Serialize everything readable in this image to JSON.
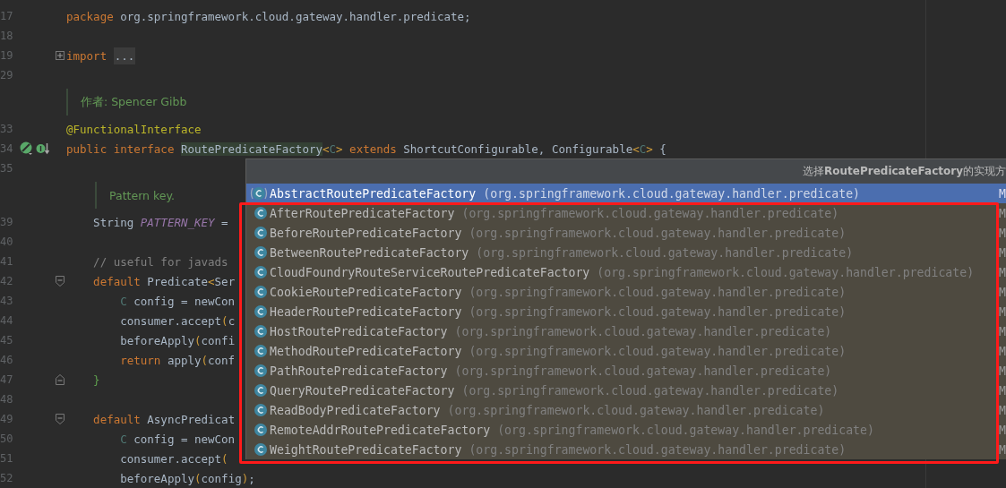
{
  "editor": {
    "lines": [
      {
        "kind": "code",
        "number": "17",
        "tokens": [
          {
            "kind": "keyword",
            "text": "package"
          },
          {
            "kind": "plain",
            "text": " org.springframework.cloud.gateway.handler.predicate;"
          }
        ]
      },
      {
        "kind": "code",
        "number": "18"
      },
      {
        "kind": "code",
        "number": "19",
        "fold": {
          "kind": "collapsed"
        },
        "tokens": [
          {
            "kind": "keyword",
            "text": "import "
          },
          {
            "kind": "folded",
            "text": "..."
          }
        ]
      },
      {
        "kind": "code",
        "number": "29"
      },
      {
        "kind": "doc",
        "text": "作者: Spencer Gibb"
      },
      {
        "kind": "code",
        "number": "33",
        "tokens": [
          {
            "kind": "annotation",
            "text": "@FunctionalInterface"
          }
        ]
      },
      {
        "kind": "code",
        "number": "34",
        "markers": true,
        "tokens": [
          {
            "kind": "keyword",
            "text": "public interface "
          },
          {
            "kind": "highlight",
            "text": "RoutePredicateFactory"
          },
          {
            "kind": "bracket",
            "text": "<"
          },
          {
            "kind": "typeparam",
            "text": "C"
          },
          {
            "kind": "bracket",
            "text": ">"
          },
          {
            "kind": "keyword",
            "text": " extends"
          },
          {
            "kind": "plain",
            "text": " ShortcutConfigurable, Configurable"
          },
          {
            "kind": "bracket",
            "text": "<"
          },
          {
            "kind": "typeparam",
            "text": "C"
          },
          {
            "kind": "bracket",
            "text": ">"
          },
          {
            "kind": "plain",
            "text": " {"
          }
        ]
      },
      {
        "kind": "code",
        "number": "35"
      },
      {
        "kind": "member_doc",
        "text": "Pattern key."
      },
      {
        "kind": "code",
        "number": "39",
        "tokens": [
          {
            "kind": "plain",
            "text": "    String "
          },
          {
            "kind": "constant",
            "text": "PATTERN_KEY"
          },
          {
            "kind": "plain",
            "text": " ="
          }
        ]
      },
      {
        "kind": "code",
        "number": "40"
      },
      {
        "kind": "code",
        "number": "41",
        "tokens": [
          {
            "kind": "comment",
            "text": "    // useful for javads"
          }
        ]
      },
      {
        "kind": "code",
        "number": "42",
        "fold": {
          "kind": "start"
        },
        "tokens": [
          {
            "kind": "keyword",
            "text": "    default"
          },
          {
            "kind": "plain",
            "text": " Predicate"
          },
          {
            "kind": "bracket",
            "text": "<"
          },
          {
            "kind": "plain",
            "text": "Ser"
          }
        ]
      },
      {
        "kind": "code",
        "number": "43",
        "tokens": [
          {
            "kind": "typeparam",
            "text": "        C"
          },
          {
            "kind": "plain",
            "text": " config = newCon"
          }
        ]
      },
      {
        "kind": "code",
        "number": "44",
        "tokens": [
          {
            "kind": "plain",
            "text": "        consumer.accept"
          },
          {
            "kind": "bracket",
            "text": "("
          },
          {
            "kind": "plain",
            "text": "c"
          }
        ]
      },
      {
        "kind": "code",
        "number": "45",
        "tokens": [
          {
            "kind": "plain",
            "text": "        beforeApply"
          },
          {
            "kind": "bracket",
            "text": "("
          },
          {
            "kind": "plain",
            "text": "confi"
          }
        ]
      },
      {
        "kind": "code",
        "number": "46",
        "tokens": [
          {
            "kind": "keyword",
            "text": "        return"
          },
          {
            "kind": "plain",
            "text": " apply"
          },
          {
            "kind": "bracket",
            "text": "("
          },
          {
            "kind": "plain",
            "text": "conf"
          }
        ]
      },
      {
        "kind": "code",
        "number": "47",
        "fold": {
          "kind": "end"
        },
        "tokens": [
          {
            "kind": "brace",
            "text": "    }"
          }
        ]
      },
      {
        "kind": "code",
        "number": "48"
      },
      {
        "kind": "code",
        "number": "49",
        "fold": {
          "kind": "start"
        },
        "tokens": [
          {
            "kind": "keyword",
            "text": "    default"
          },
          {
            "kind": "plain",
            "text": " AsyncPredicat"
          }
        ]
      },
      {
        "kind": "code",
        "number": "50",
        "tokens": [
          {
            "kind": "typeparam",
            "text": "        C"
          },
          {
            "kind": "plain",
            "text": " config = newCon"
          }
        ]
      },
      {
        "kind": "code",
        "number": "51",
        "tokens": [
          {
            "kind": "plain",
            "text": "        consumer.accept"
          },
          {
            "kind": "bracket",
            "text": "("
          }
        ]
      },
      {
        "kind": "code",
        "number": "52",
        "tokens": [
          {
            "kind": "plain",
            "text": "        beforeApply"
          },
          {
            "kind": "bracket",
            "text": "("
          },
          {
            "kind": "plain",
            "text": "config"
          },
          {
            "kind": "bracket",
            "text": ")"
          },
          {
            "kind": "plain",
            "text": ";"
          }
        ]
      }
    ]
  },
  "popup": {
    "title": "选择**RoutePredicateFactory**的实现方",
    "items": [
      {
        "name": "AbstractRoutePredicateFactory",
        "package": "(org.springframework.cloud.gateway.handler.predicate)",
        "module": "M",
        "abstract": true,
        "selected": true
      },
      {
        "name": "AfterRoutePredicateFactory",
        "package": "(org.springframework.cloud.gateway.handler.predicate)",
        "module": "M",
        "abstract": false,
        "selected": false
      },
      {
        "name": "BeforeRoutePredicateFactory",
        "package": "(org.springframework.cloud.gateway.handler.predicate)",
        "module": "M",
        "abstract": false,
        "selected": false
      },
      {
        "name": "BetweenRoutePredicateFactory",
        "package": "(org.springframework.cloud.gateway.handler.predicate)",
        "module": "M",
        "abstract": false,
        "selected": false
      },
      {
        "name": "CloudFoundryRouteServiceRoutePredicateFactory",
        "package": "(org.springframework.cloud.gateway.handler.predicate)",
        "module": "M",
        "abstract": false,
        "selected": false
      },
      {
        "name": "CookieRoutePredicateFactory",
        "package": "(org.springframework.cloud.gateway.handler.predicate)",
        "module": "M",
        "abstract": false,
        "selected": false
      },
      {
        "name": "HeaderRoutePredicateFactory",
        "package": "(org.springframework.cloud.gateway.handler.predicate)",
        "module": "M",
        "abstract": false,
        "selected": false
      },
      {
        "name": "HostRoutePredicateFactory",
        "package": "(org.springframework.cloud.gateway.handler.predicate)",
        "module": "M",
        "abstract": false,
        "selected": false
      },
      {
        "name": "MethodRoutePredicateFactory",
        "package": "(org.springframework.cloud.gateway.handler.predicate)",
        "module": "M",
        "abstract": false,
        "selected": false
      },
      {
        "name": "PathRoutePredicateFactory",
        "package": "(org.springframework.cloud.gateway.handler.predicate)",
        "module": "M",
        "abstract": false,
        "selected": false
      },
      {
        "name": "QueryRoutePredicateFactory",
        "package": "(org.springframework.cloud.gateway.handler.predicate)",
        "module": "M",
        "abstract": false,
        "selected": false
      },
      {
        "name": "ReadBodyPredicateFactory",
        "package": "(org.springframework.cloud.gateway.handler.predicate)",
        "module": "M",
        "abstract": false,
        "selected": false
      },
      {
        "name": "RemoteAddrRoutePredicateFactory",
        "package": "(org.springframework.cloud.gateway.handler.predicate)",
        "module": "M",
        "abstract": false,
        "selected": false
      },
      {
        "name": "WeightRoutePredicateFactory",
        "package": "(org.springframework.cloud.gateway.handler.predicate)",
        "module": "M",
        "abstract": false,
        "selected": false
      }
    ]
  }
}
